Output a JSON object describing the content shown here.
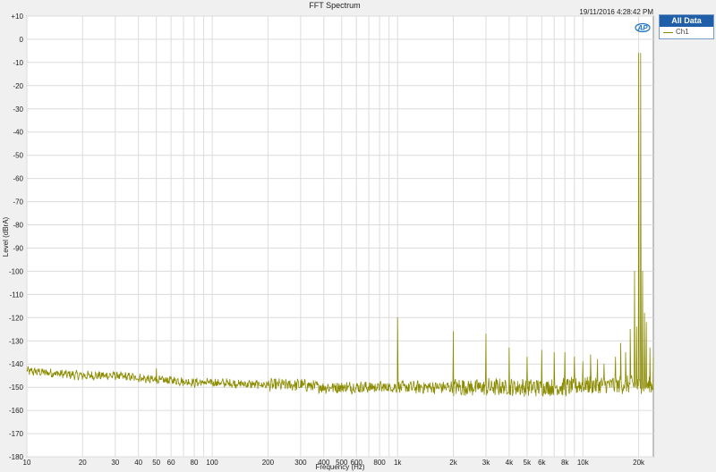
{
  "colors": {
    "series": "#8b8b00",
    "legend_header_bg": "#1f5ea8",
    "logo": "#1a73c9"
  },
  "header": {
    "title": "FFT Spectrum",
    "timestamp": "19/11/2016 4:28:42 PM",
    "logo_icon": "ap-logo-icon"
  },
  "legend": {
    "header": "All Data",
    "items": [
      {
        "label": "Ch1"
      }
    ]
  },
  "chart_data": {
    "type": "line",
    "title": "FFT Spectrum",
    "xlabel": "Frequency (Hz)",
    "ylabel": "Level (dBrA)",
    "xscale": "log",
    "xlim": [
      10,
      24000
    ],
    "ylim": [
      -180,
      10
    ],
    "grid": true,
    "legend_position": "right",
    "xticks": [
      10,
      20,
      30,
      40,
      50,
      60,
      80,
      100,
      200,
      300,
      400,
      500,
      600,
      800,
      1000,
      2000,
      3000,
      4000,
      5000,
      6000,
      8000,
      10000,
      20000
    ],
    "xtick_labels": [
      "10",
      "20",
      "30",
      "40",
      "50",
      "60",
      "80",
      "100",
      "200",
      "300",
      "400",
      "500",
      "600",
      "800",
      "1k",
      "2k",
      "3k",
      "4k",
      "5k",
      "6k",
      "8k",
      "10k",
      "20k"
    ],
    "yticks": [
      10,
      0,
      -10,
      -20,
      -30,
      -40,
      -50,
      -60,
      -70,
      -80,
      -90,
      -100,
      -110,
      -120,
      -130,
      -140,
      -150,
      -160,
      -170,
      -180
    ],
    "ytick_labels": [
      "+10",
      "0",
      "-10",
      "-20",
      "-30",
      "-40",
      "-50",
      "-60",
      "-70",
      "-80",
      "-90",
      "-100",
      "-110",
      "-120",
      "-130",
      "-140",
      "-150",
      "-160",
      "-170",
      "-180"
    ],
    "series": [
      {
        "name": "Ch1",
        "noise_floor": {
          "x": [
            10,
            20,
            30,
            40,
            50,
            60,
            80,
            100,
            200,
            300,
            400,
            500,
            600,
            800,
            1000,
            2000,
            3000,
            4000,
            5000,
            6000,
            8000,
            10000,
            20000,
            24000
          ],
          "y": [
            -143,
            -145,
            -145,
            -146,
            -147,
            -147,
            -148,
            -148,
            -149,
            -149,
            -150,
            -150,
            -150,
            -150,
            -150,
            -150,
            -150,
            -150,
            -150,
            -150,
            -150,
            -149,
            -149,
            -149
          ]
        },
        "peaks": [
          {
            "x": 50,
            "y": -142
          },
          {
            "x": 1000,
            "y": -120
          },
          {
            "x": 2000,
            "y": -126
          },
          {
            "x": 3000,
            "y": -127
          },
          {
            "x": 4000,
            "y": -133
          },
          {
            "x": 5000,
            "y": -137
          },
          {
            "x": 6000,
            "y": -134
          },
          {
            "x": 7000,
            "y": -135
          },
          {
            "x": 8000,
            "y": -135
          },
          {
            "x": 9000,
            "y": -137
          },
          {
            "x": 10000,
            "y": -139
          },
          {
            "x": 11000,
            "y": -136
          },
          {
            "x": 12000,
            "y": -138
          },
          {
            "x": 13000,
            "y": -140
          },
          {
            "x": 15000,
            "y": -137
          },
          {
            "x": 16000,
            "y": -131
          },
          {
            "x": 17000,
            "y": -135
          },
          {
            "x": 18000,
            "y": -125
          },
          {
            "x": 19000,
            "y": -100
          },
          {
            "x": 19500,
            "y": -124
          },
          {
            "x": 20000,
            "y": -6
          },
          {
            "x": 20500,
            "y": -6
          },
          {
            "x": 21000,
            "y": -100
          },
          {
            "x": 21500,
            "y": -118
          },
          {
            "x": 22000,
            "y": -122
          },
          {
            "x": 23000,
            "y": -133
          },
          {
            "x": 24000,
            "y": -137
          }
        ]
      }
    ]
  }
}
